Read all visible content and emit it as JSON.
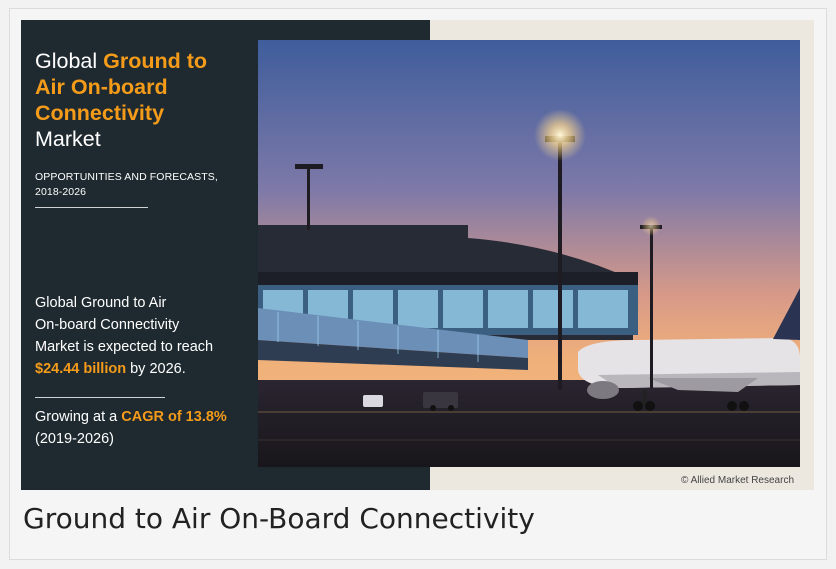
{
  "infographic": {
    "title": {
      "line1_prefix": "Global",
      "line1_accent": "Ground to",
      "line2_accent": "Air On-board",
      "line3_accent": "Connectivity",
      "line4": "Market"
    },
    "subtitle_line1": "OPPORTUNITIES AND FORECASTS,",
    "subtitle_line2": "2018-2026",
    "statement": {
      "line1": "Global Ground to Air",
      "line2": "On-board Connectivity",
      "line3": "Market is expected to reach",
      "value": "$24.44 billion",
      "suffix": "by 2026."
    },
    "growth": {
      "prefix": "Growing at a",
      "cagr": "CAGR of 13.8%",
      "period": "(2019-2026)"
    },
    "copyright": "© Allied Market Research",
    "colors": {
      "accent": "#f59b1a",
      "panel": "#1f2a30"
    }
  },
  "caption": "Ground to Air On-Board Connectivity"
}
